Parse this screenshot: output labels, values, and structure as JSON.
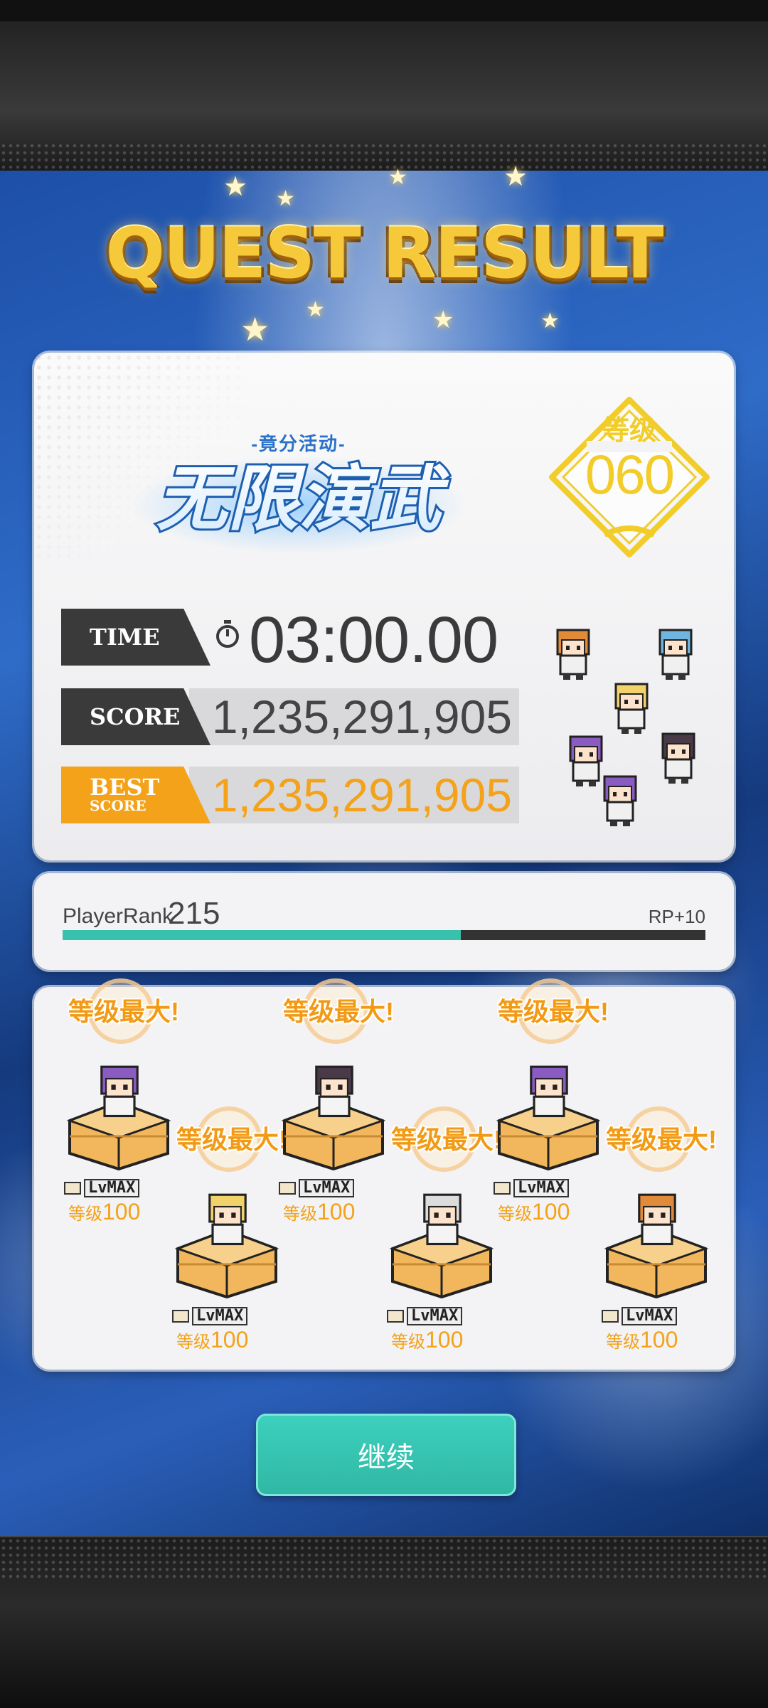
{
  "title": "QUEST RESULT",
  "event": {
    "subtitle": "-竟分活动-",
    "name": "无限演武"
  },
  "level": {
    "label": "等级",
    "value": "060"
  },
  "stats": {
    "time_label": "TIME",
    "time_value": "03:00.00",
    "score_label": "SCORE",
    "score_value": "1,235,291,905",
    "best_label": "BEST",
    "best_sub_label": "SCORE",
    "best_value": "1,235,291,905"
  },
  "player_rank": {
    "label": "PlayerRank",
    "value": "215",
    "rp": "RP+10",
    "progress": 0.62
  },
  "units": [
    {
      "max_label": "等级最大!",
      "lv_label": "LvMAX",
      "level_prefix": "等级",
      "level": "100",
      "hair": "#8a5bc0"
    },
    {
      "max_label": "等级最大!",
      "lv_label": "LvMAX",
      "level_prefix": "等级",
      "level": "100",
      "hair": "#f2d36b"
    },
    {
      "max_label": "等级最大!",
      "lv_label": "LvMAX",
      "level_prefix": "等级",
      "level": "100",
      "hair": "#4a3a48"
    },
    {
      "max_label": "等级最大!",
      "lv_label": "LvMAX",
      "level_prefix": "等级",
      "level": "100",
      "hair": "#dcdcdc"
    },
    {
      "max_label": "等级最大!",
      "lv_label": "LvMAX",
      "level_prefix": "等级",
      "level": "100",
      "hair": "#8a5bc0"
    },
    {
      "max_label": "等级最大!",
      "lv_label": "LvMAX",
      "level_prefix": "等级",
      "level": "100",
      "hair": "#e08a3a"
    }
  ],
  "continue_label": "继续",
  "colors": {
    "accent": "#38c2ad",
    "orange": "#f3a21a",
    "gold": "#f2cd2a",
    "dark": "#3a3a3a"
  }
}
